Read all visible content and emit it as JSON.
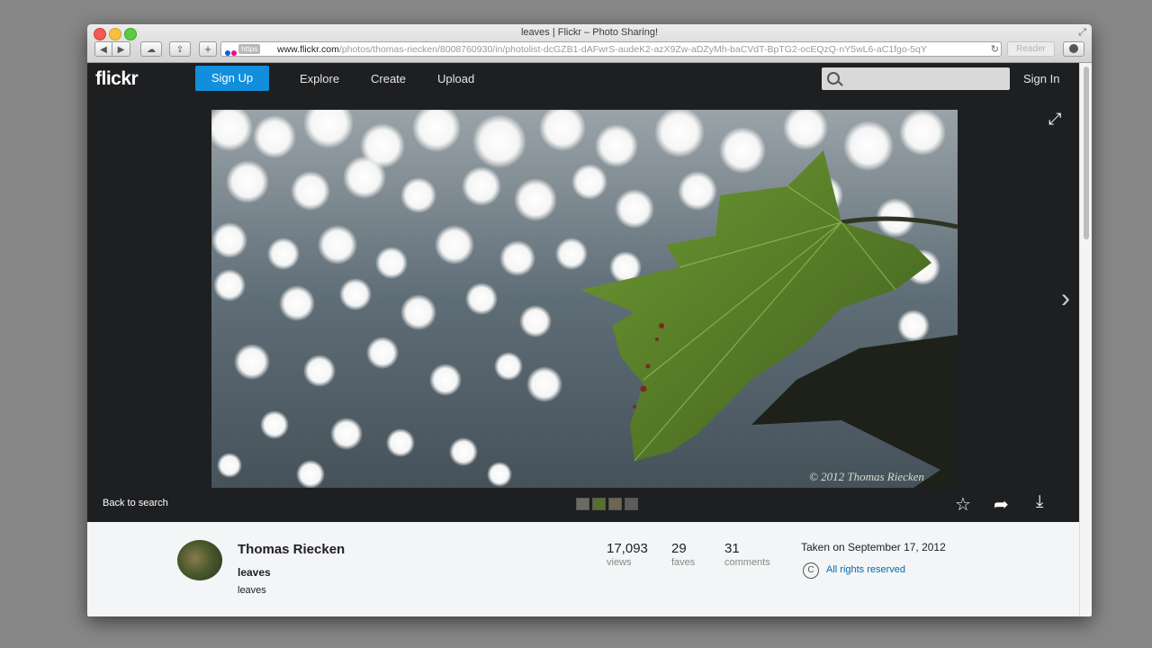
{
  "browser": {
    "window_title": "leaves | Flickr – Photo Sharing!",
    "https_label": "https",
    "url_host": "www.flickr.com",
    "url_path": "/photos/thomas-riecken/8008760930/in/photolist-dcGZB1-dAFwrS-audeK2-azX9Zw-aDZyMh-baCVdT-BpTG2-ocEQzQ-nY5wL6-aC1fgo-5qY",
    "reader_label": "Reader",
    "plus_label": "+"
  },
  "nav": {
    "logo": "flickr",
    "signup": "Sign Up",
    "links": [
      "Explore",
      "Create",
      "Upload"
    ],
    "signin": "Sign In"
  },
  "photo": {
    "watermark": "© 2012 Thomas Riecken"
  },
  "viewer": {
    "back_to_search": "Back to search",
    "filmstrip_colors": [
      "#6b6b63",
      "#55702e",
      "#6d6650",
      "#5a5d5a"
    ]
  },
  "info": {
    "owner": "Thomas Riecken",
    "title": "leaves",
    "description": "leaves",
    "stats": [
      {
        "value": "17,093",
        "label": "views"
      },
      {
        "value": "29",
        "label": "faves"
      },
      {
        "value": "31",
        "label": "comments"
      }
    ],
    "taken": "Taken on September 17, 2012",
    "copyright_symbol": "C",
    "rights": "All rights reserved"
  },
  "colors": {
    "accent": "#128fdc",
    "link": "#006dac",
    "page_bg": "#1e1f21"
  }
}
